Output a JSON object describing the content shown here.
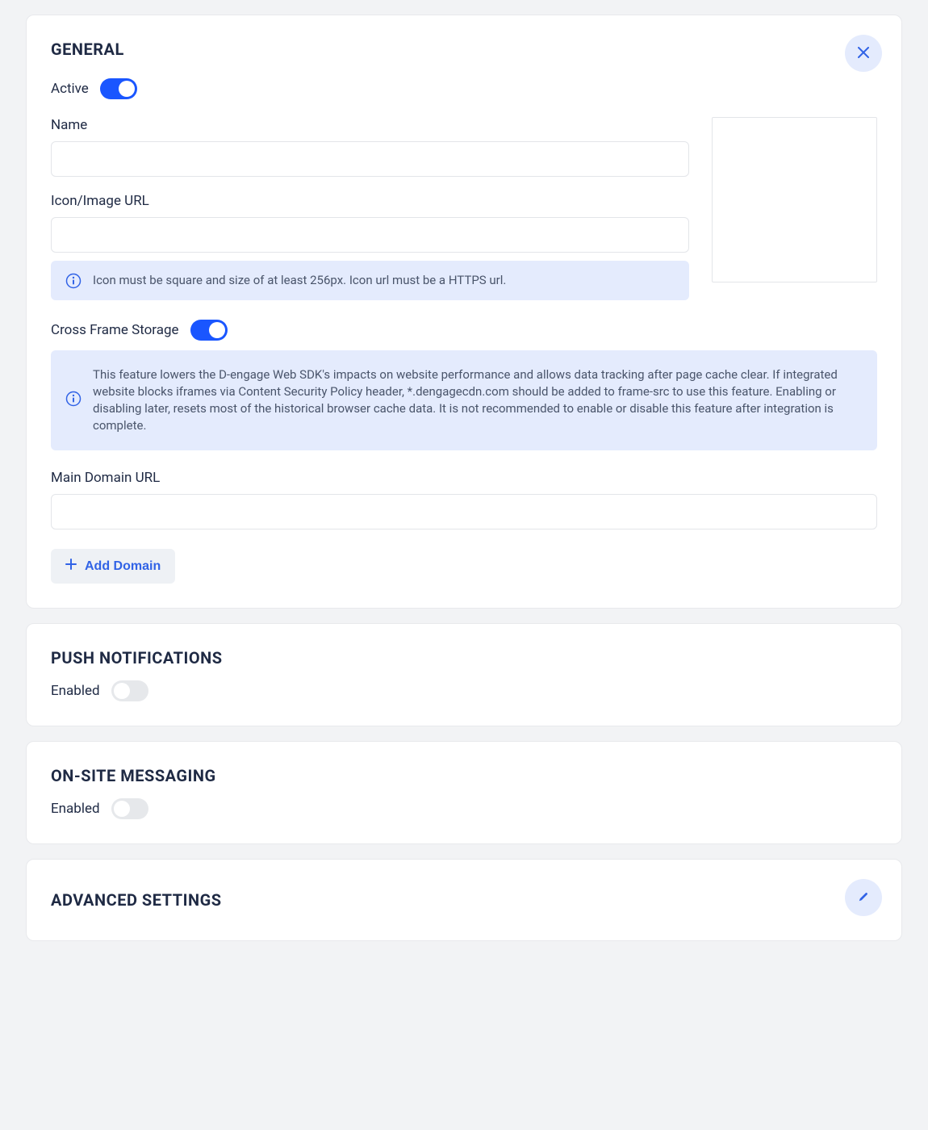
{
  "general": {
    "title": "GENERAL",
    "active_label": "Active",
    "active_on": true,
    "name_label": "Name",
    "name_value": "",
    "icon_url_label": "Icon/Image URL",
    "icon_url_value": "",
    "icon_info": "Icon must be square and size of at least 256px. Icon url must be a HTTPS url.",
    "cross_frame_label": "Cross Frame Storage",
    "cross_frame_on": true,
    "cross_frame_info": "This feature lowers the D-engage Web SDK's impacts on website performance and allows data tracking after page cache clear. If integrated website blocks iframes via Content Security Policy header, *.dengagecdn.com should be added to frame-src to use this feature. Enabling or disabling later, resets most of the historical browser cache data. It is not recommended to enable or disable this feature after integration is complete.",
    "main_domain_label": "Main Domain URL",
    "main_domain_value": "",
    "add_domain_label": "Add Domain"
  },
  "push": {
    "title": "PUSH NOTIFICATIONS",
    "enabled_label": "Enabled",
    "enabled_on": false
  },
  "onsite": {
    "title": "ON-SITE MESSAGING",
    "enabled_label": "Enabled",
    "enabled_on": false
  },
  "advanced": {
    "title": "ADVANCED SETTINGS"
  }
}
